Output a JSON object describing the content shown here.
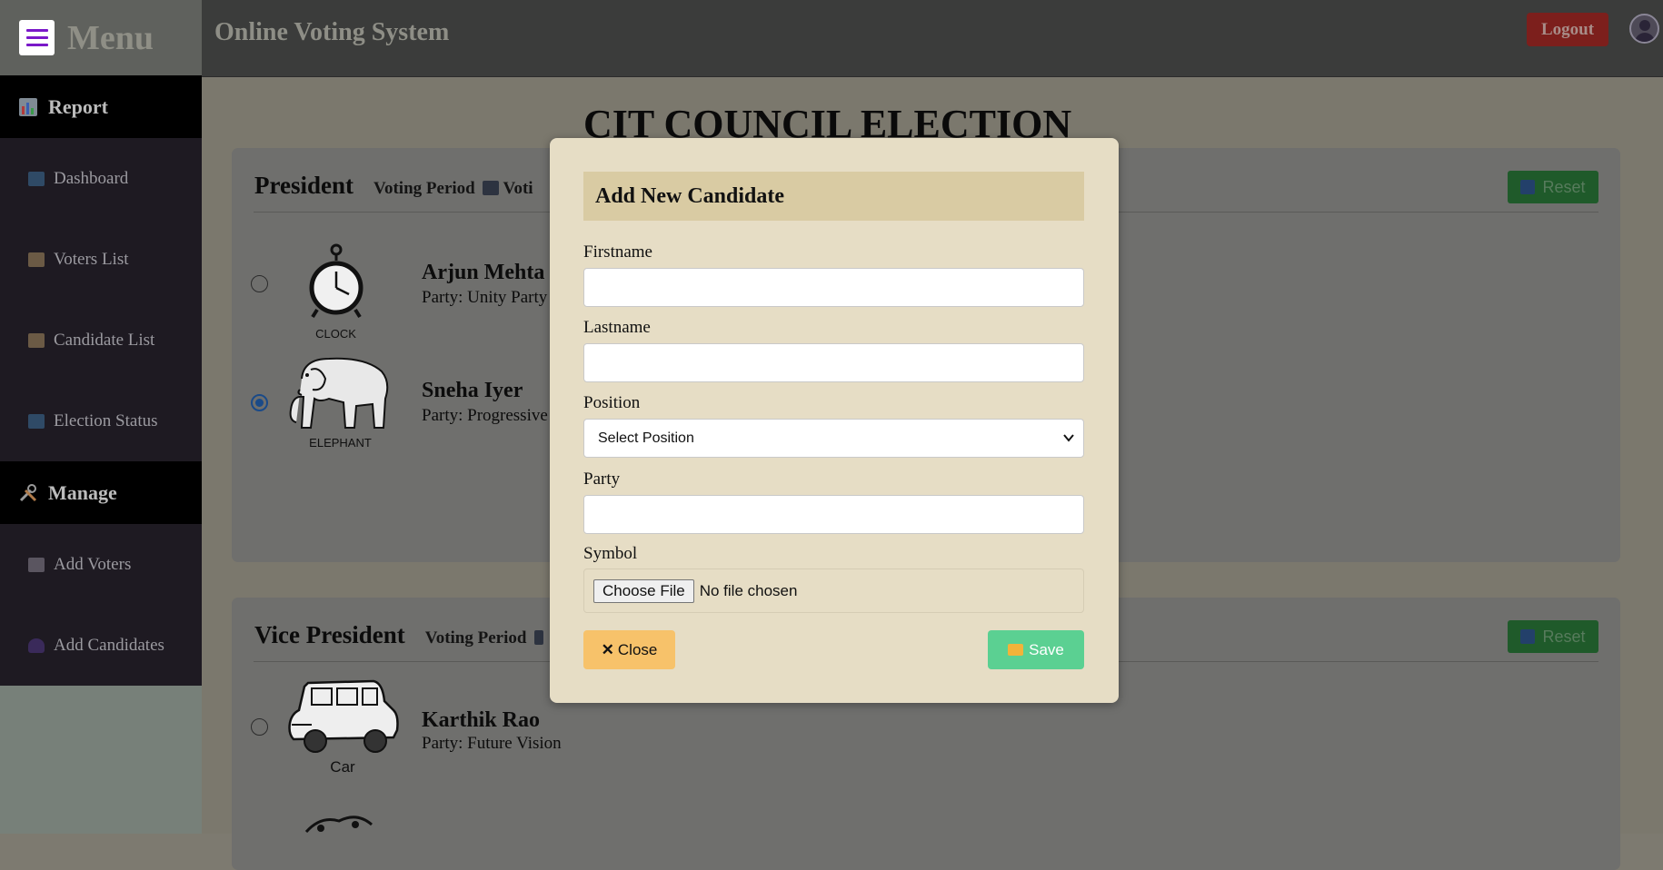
{
  "sidebar": {
    "menu_title": "Menu",
    "sections": [
      {
        "label": "Report",
        "icon": "chart-icon",
        "items": [
          {
            "label": "Dashboard",
            "icon": "laptop-icon"
          },
          {
            "label": "Voters List",
            "icon": "clipboard-icon"
          },
          {
            "label": "Candidate List",
            "icon": "clipboard-icon"
          },
          {
            "label": "Election Status",
            "icon": "laptop-icon"
          }
        ]
      },
      {
        "label": "Manage",
        "icon": "tools-icon",
        "items": [
          {
            "label": "Add Voters",
            "icon": "clipboard-icon"
          },
          {
            "label": "Add Candidates",
            "icon": "user-icon"
          }
        ]
      }
    ]
  },
  "header": {
    "app_title": "Online Voting System",
    "logout_label": "Logout"
  },
  "main": {
    "page_title": "CIT COUNCIL ELECTION",
    "cards": [
      {
        "position": "President",
        "voting_period": "Voting Period",
        "voting_fragment": "Voti",
        "reset_label": "Reset",
        "candidates": [
          {
            "name": "Arjun Mehta",
            "party": "Party: Unity Party",
            "symbol_label": "CLOCK",
            "selected": false
          },
          {
            "name": "Sneha Iyer",
            "party": "Party: Progressive",
            "symbol_label": "ELEPHANT",
            "selected": true
          }
        ]
      },
      {
        "position": "Vice President",
        "voting_period": "Voting Period",
        "reset_label": "Reset",
        "candidates": [
          {
            "name": "Karthik Rao",
            "party": "Party: Future Vision",
            "symbol_label": "Car",
            "selected": false
          }
        ]
      }
    ]
  },
  "modal": {
    "title": "Add New Candidate",
    "fields": {
      "firstname_label": "Firstname",
      "firstname_value": "",
      "lastname_label": "Lastname",
      "lastname_value": "",
      "position_label": "Position",
      "position_selected": "Select Position",
      "party_label": "Party",
      "party_value": "",
      "symbol_label": "Symbol",
      "file_button": "Choose File",
      "file_status": "No file chosen"
    },
    "close_label": "Close",
    "save_label": "Save"
  },
  "colors": {
    "accent_purple": "#7a18c9",
    "save_green": "#5bd092",
    "close_orange": "#f7c26a",
    "modal_bg": "#e6ddc5",
    "modal_header": "#d9cba3"
  }
}
